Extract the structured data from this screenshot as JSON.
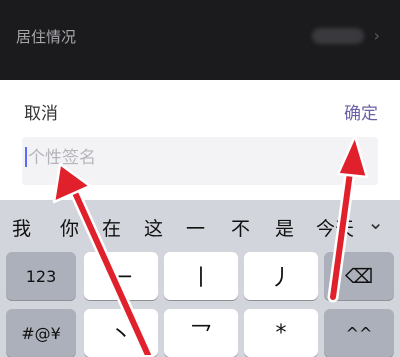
{
  "background_row": {
    "label": "居住情况"
  },
  "dialog": {
    "cancel_label": "取消",
    "confirm_label": "确定",
    "input_placeholder": "个性签名",
    "input_value": ""
  },
  "keyboard": {
    "candidates": [
      "我",
      "你",
      "在",
      "这",
      "一",
      "不",
      "是",
      "今天"
    ],
    "expand_icon": "chevron-down-icon",
    "row1": [
      "123",
      "一",
      "丨",
      "丿",
      "⌫"
    ],
    "row2": [
      "#@¥",
      "丶",
      "乛",
      "*",
      "^^"
    ]
  },
  "colors": {
    "accent": "#6b5fa7",
    "annotation_arrow": "#e0202a",
    "caret": "#5a6bff"
  }
}
